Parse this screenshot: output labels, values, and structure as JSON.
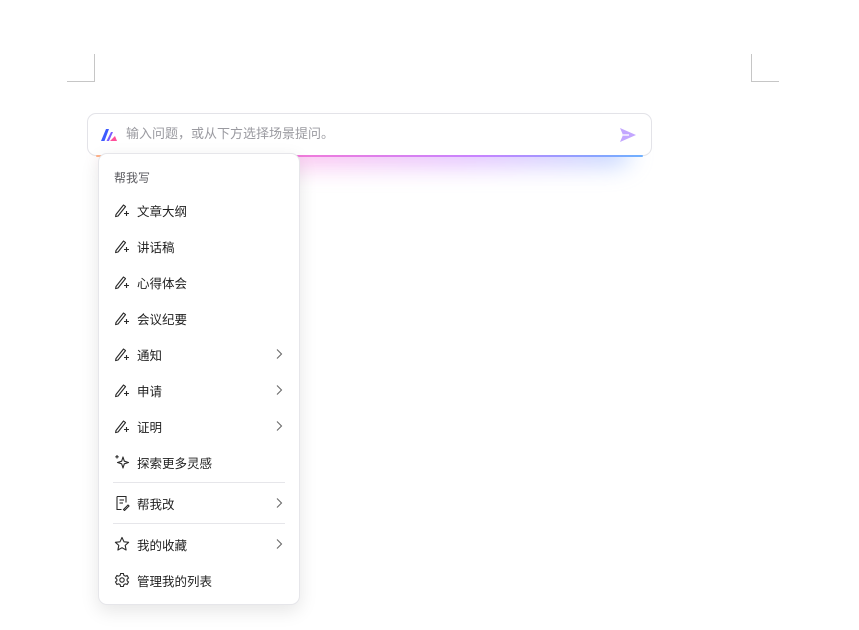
{
  "prompt": {
    "placeholder": "输入问题，或从下方选择场景提问。",
    "brand_icon": "wps-ai-logo-icon",
    "send_icon": "send-arrow-icon"
  },
  "menu": {
    "section_title": "帮我写",
    "write_items": [
      {
        "label": "文章大纲",
        "icon": "pen-sparkle-icon",
        "has_submenu": false
      },
      {
        "label": "讲话稿",
        "icon": "pen-sparkle-icon",
        "has_submenu": false
      },
      {
        "label": "心得体会",
        "icon": "pen-sparkle-icon",
        "has_submenu": false
      },
      {
        "label": "会议纪要",
        "icon": "pen-sparkle-icon",
        "has_submenu": false
      },
      {
        "label": "通知",
        "icon": "pen-sparkle-icon",
        "has_submenu": true
      },
      {
        "label": "申请",
        "icon": "pen-sparkle-icon",
        "has_submenu": true
      },
      {
        "label": "证明",
        "icon": "pen-sparkle-icon",
        "has_submenu": true
      },
      {
        "label": "探索更多灵感",
        "icon": "sparkle-icon",
        "has_submenu": false
      }
    ],
    "edit_item": {
      "label": "帮我改",
      "icon": "edit-doc-icon",
      "has_submenu": true
    },
    "favorites_item": {
      "label": "我的收藏",
      "icon": "star-icon",
      "has_submenu": true
    },
    "manage_item": {
      "label": "管理我的列表",
      "icon": "gear-icon",
      "has_submenu": false
    }
  },
  "colors": {
    "accent_purple": "#b08cff",
    "brand_blue": "#3d5bff",
    "brand_pink": "#ff4f9a"
  }
}
